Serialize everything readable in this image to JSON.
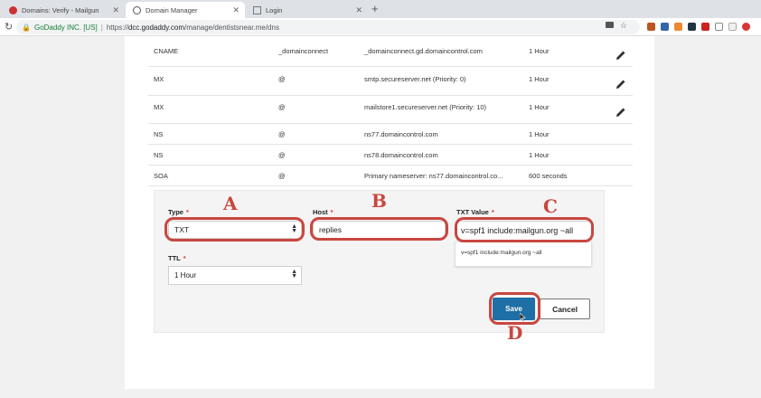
{
  "browser": {
    "tabs": [
      {
        "label": "Domains: Verify - Mailgun"
      },
      {
        "label": "Domain Manager"
      },
      {
        "label": "Login"
      }
    ],
    "new_tab_glyph": "+",
    "address": {
      "security_name": "GoDaddy INC. [US]",
      "separator": "|",
      "scheme": "https://",
      "host": "dcc.godaddy.com",
      "path": "/manage/dentistsnear.me/dns"
    }
  },
  "records": [
    {
      "type": "CNAME",
      "name": "_domainconnect",
      "value": "_domainconnect.gd.domaincontrol.com",
      "ttl": "1 Hour",
      "editable": true
    },
    {
      "type": "MX",
      "name": "@",
      "value": "smtp.secureserver.net (Priority: 0)",
      "ttl": "1 Hour",
      "editable": true
    },
    {
      "type": "MX",
      "name": "@",
      "value": "mailstore1.secureserver.net (Priority: 10)",
      "ttl": "1 Hour",
      "editable": true
    },
    {
      "type": "NS",
      "name": "@",
      "value": "ns77.domaincontrol.com",
      "ttl": "1 Hour",
      "editable": false
    },
    {
      "type": "NS",
      "name": "@",
      "value": "ns78.domaincontrol.com",
      "ttl": "1 Hour",
      "editable": false
    },
    {
      "type": "SOA",
      "name": "@",
      "value": "Primary nameserver: ns77.domaincontrol.co...",
      "ttl": "600 seconds",
      "editable": false
    }
  ],
  "form": {
    "type_label": "Type",
    "type_value": "TXT",
    "host_label": "Host",
    "host_value": "replies",
    "txt_label": "TXT Value",
    "txt_value": "v=spf1 include:mailgun.org ~all",
    "txt_suggestion": "v=spf1 include:mailgun.org ~all",
    "ttl_label": "TTL",
    "ttl_value": "1 Hour",
    "required_mark": "*",
    "save_label": "Save",
    "cancel_label": "Cancel"
  },
  "annotations": {
    "markers": [
      "A",
      "B",
      "C",
      "D"
    ],
    "color": "#c8473f"
  },
  "colors": {
    "save_button": "#1d6fa5",
    "secure_green": "#188038"
  }
}
